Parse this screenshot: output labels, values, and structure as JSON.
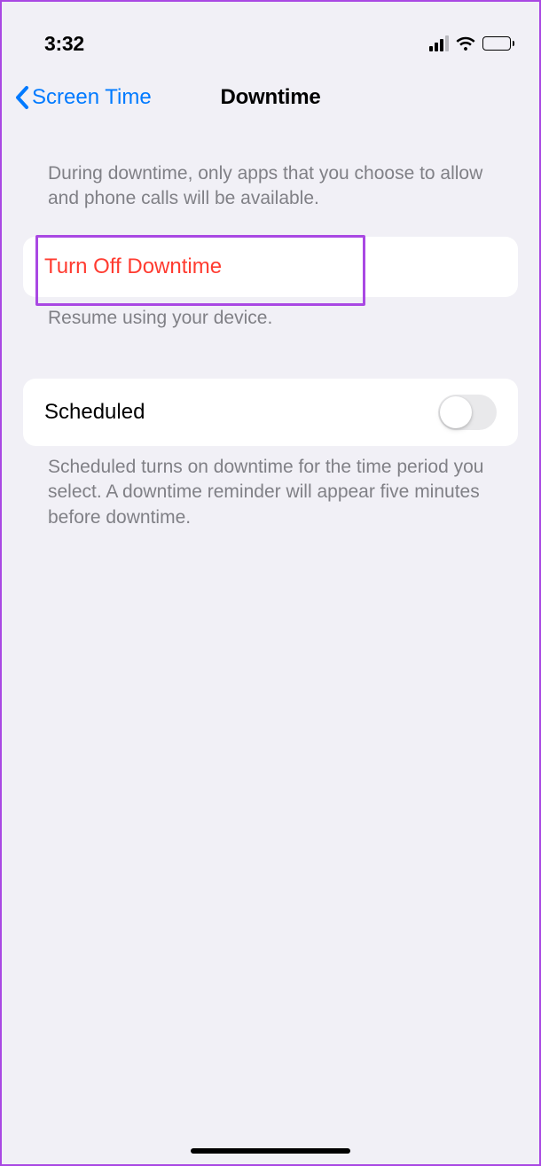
{
  "status": {
    "time": "3:32"
  },
  "nav": {
    "back_label": "Screen Time",
    "title": "Downtime"
  },
  "sections": {
    "intro_desc": "During downtime, only apps that you choose to allow and phone calls will be available.",
    "turn_off_label": "Turn Off Downtime",
    "turn_off_caption": "Resume using your device.",
    "scheduled_label": "Scheduled",
    "scheduled_toggle_on": false,
    "scheduled_caption": "Scheduled turns on downtime for the time period you select. A downtime reminder will appear five minutes before downtime."
  }
}
